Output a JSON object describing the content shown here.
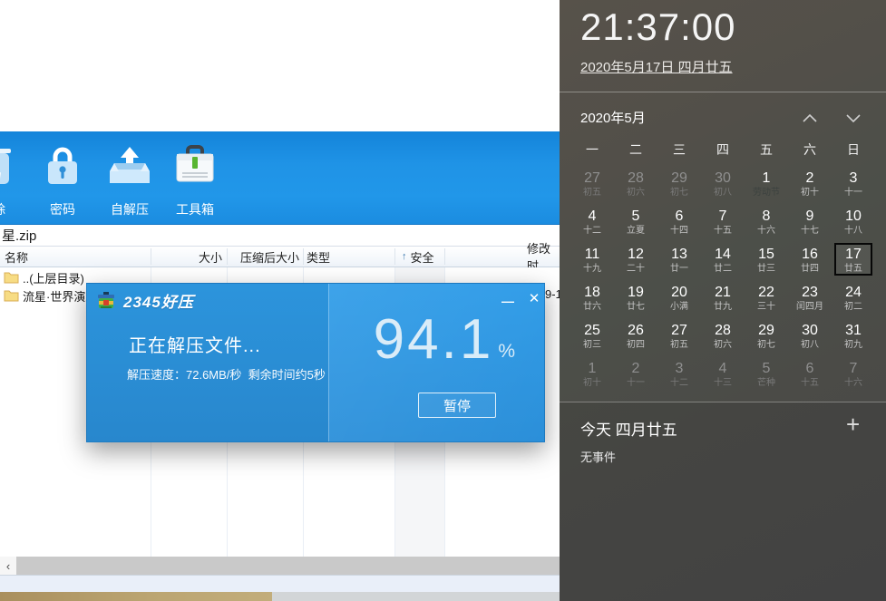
{
  "archiver": {
    "toolbar": {
      "delete_label": "删除",
      "buttons": [
        {
          "label": "密码",
          "icon": "lock-icon"
        },
        {
          "label": "自解压",
          "icon": "self-extract-icon"
        },
        {
          "label": "工具箱",
          "icon": "toolbox-icon"
        }
      ]
    },
    "address": "星.zip",
    "columns": [
      "名称",
      "大小",
      "压缩后大小",
      "类型",
      "安全",
      "修改时"
    ],
    "sort_indicator": "↑",
    "sort_column": "安全",
    "rows": [
      {
        "name": "..(上层目录)"
      },
      {
        "name": "流星·世界演绎",
        "modified_fragment": "9-1"
      }
    ],
    "scrollbar_left_glyph": "‹"
  },
  "dialog": {
    "app_name": "2345好压",
    "status": "正在解压文件...",
    "detail": "解压速度：72.6MB/秒  剩余时间约5秒",
    "percent": "94.1",
    "percent_sign": "%",
    "pause_label": "暂停",
    "minimize_glyph": "—",
    "close_glyph": "✕"
  },
  "calendar": {
    "clock": "21:37:00",
    "date_link": "2020年5月17日 四月廿五",
    "month_label": "2020年5月",
    "weekdays": [
      "一",
      "二",
      "三",
      "四",
      "五",
      "六",
      "日"
    ],
    "weeks": [
      [
        {
          "d": "27",
          "l": "初五",
          "s": "dim"
        },
        {
          "d": "28",
          "l": "初六",
          "s": "dim"
        },
        {
          "d": "29",
          "l": "初七",
          "s": "dim"
        },
        {
          "d": "30",
          "l": "初八",
          "s": "dim"
        },
        {
          "d": "1",
          "l": "劳动节",
          "s": "holiday"
        },
        {
          "d": "2",
          "l": "初十",
          "s": "cur"
        },
        {
          "d": "3",
          "l": "十一",
          "s": "cur"
        }
      ],
      [
        {
          "d": "4",
          "l": "十二",
          "s": "cur"
        },
        {
          "d": "5",
          "l": "立夏",
          "s": "cur"
        },
        {
          "d": "6",
          "l": "十四",
          "s": "cur"
        },
        {
          "d": "7",
          "l": "十五",
          "s": "cur"
        },
        {
          "d": "8",
          "l": "十六",
          "s": "cur"
        },
        {
          "d": "9",
          "l": "十七",
          "s": "cur"
        },
        {
          "d": "10",
          "l": "十八",
          "s": "cur"
        }
      ],
      [
        {
          "d": "11",
          "l": "十九",
          "s": "cur"
        },
        {
          "d": "12",
          "l": "二十",
          "s": "cur"
        },
        {
          "d": "13",
          "l": "廿一",
          "s": "cur"
        },
        {
          "d": "14",
          "l": "廿二",
          "s": "cur"
        },
        {
          "d": "15",
          "l": "廿三",
          "s": "cur"
        },
        {
          "d": "16",
          "l": "廿四",
          "s": "cur"
        },
        {
          "d": "17",
          "l": "廿五",
          "s": "today"
        }
      ],
      [
        {
          "d": "18",
          "l": "廿六",
          "s": "cur"
        },
        {
          "d": "19",
          "l": "廿七",
          "s": "cur"
        },
        {
          "d": "20",
          "l": "小满",
          "s": "cur"
        },
        {
          "d": "21",
          "l": "廿九",
          "s": "cur"
        },
        {
          "d": "22",
          "l": "三十",
          "s": "cur"
        },
        {
          "d": "23",
          "l": "闰四月",
          "s": "cur"
        },
        {
          "d": "24",
          "l": "初二",
          "s": "cur"
        }
      ],
      [
        {
          "d": "25",
          "l": "初三",
          "s": "cur"
        },
        {
          "d": "26",
          "l": "初四",
          "s": "cur"
        },
        {
          "d": "27",
          "l": "初五",
          "s": "cur"
        },
        {
          "d": "28",
          "l": "初六",
          "s": "cur"
        },
        {
          "d": "29",
          "l": "初七",
          "s": "cur"
        },
        {
          "d": "30",
          "l": "初八",
          "s": "cur"
        },
        {
          "d": "31",
          "l": "初九",
          "s": "cur"
        }
      ],
      [
        {
          "d": "1",
          "l": "初十",
          "s": "dim"
        },
        {
          "d": "2",
          "l": "十一",
          "s": "dim"
        },
        {
          "d": "3",
          "l": "十二",
          "s": "dim"
        },
        {
          "d": "4",
          "l": "十三",
          "s": "dim"
        },
        {
          "d": "5",
          "l": "芒种",
          "s": "dim"
        },
        {
          "d": "6",
          "l": "十五",
          "s": "dim"
        },
        {
          "d": "7",
          "l": "十六",
          "s": "dim"
        }
      ]
    ],
    "today_section": {
      "title": "今天 四月廿五",
      "empty": "无事件",
      "add_glyph": "+"
    }
  },
  "colors": {
    "toolbar_blue": "#1f93e6",
    "dialog_blue": "#2d98e4",
    "panel_dark": "#4d4e48",
    "today_box_border": "#070707",
    "sorted_column_shade": "#f5f6f8",
    "desktop_tan": "#bba572",
    "status_bar": "#e9eff9"
  }
}
